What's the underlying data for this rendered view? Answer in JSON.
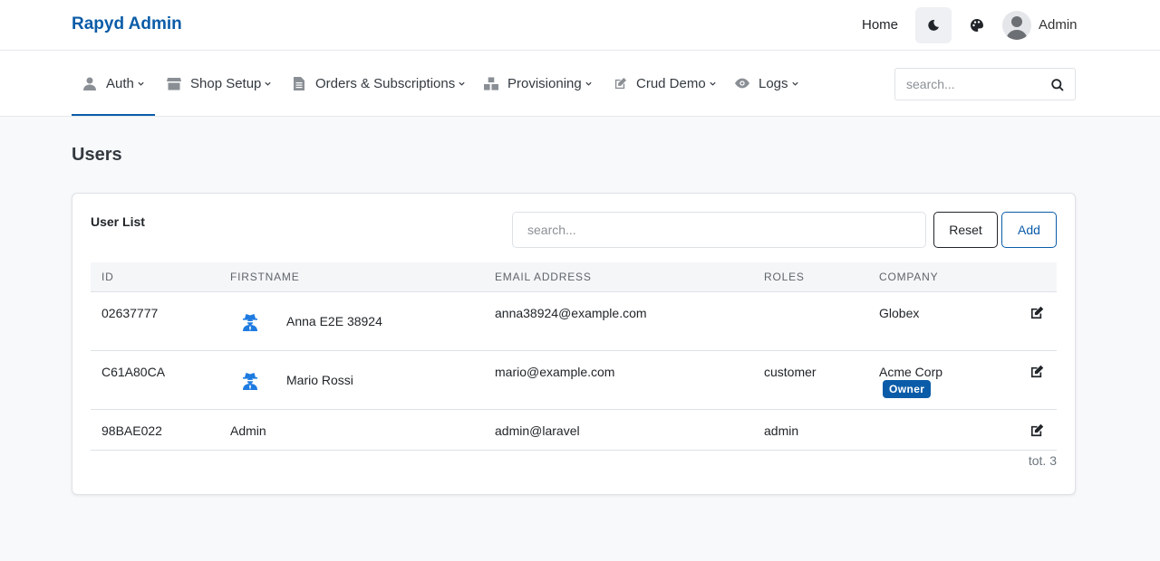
{
  "header": {
    "brand": "Rapyd Admin",
    "home_link": "Home",
    "user_name": "Admin"
  },
  "nav": {
    "items": [
      {
        "label": "Auth",
        "icon": "user-icon"
      },
      {
        "label": "Shop Setup",
        "icon": "store-icon"
      },
      {
        "label": "Orders & Subscriptions",
        "icon": "file-icon"
      },
      {
        "label": "Provisioning",
        "icon": "cubes-icon"
      },
      {
        "label": "Crud Demo",
        "icon": "edit-icon"
      },
      {
        "label": "Logs",
        "icon": "eye-icon"
      }
    ],
    "active_index": 0,
    "search_placeholder": "search..."
  },
  "page": {
    "title": "Users"
  },
  "user_list": {
    "title": "User List",
    "search_placeholder": "search...",
    "reset_label": "Reset",
    "add_label": "Add",
    "columns": [
      "ID",
      "FIRSTNAME",
      "EMAIL ADDRESS",
      "ROLES",
      "COMPANY"
    ],
    "rows": [
      {
        "id": "02637777",
        "firstname": "Anna E2E 38924",
        "email": "anna38924@example.com",
        "roles": "",
        "company": "Globex",
        "badge": "",
        "icon": "user-secret-icon"
      },
      {
        "id": "C61A80CA",
        "firstname": "Mario Rossi",
        "email": "mario@example.com",
        "roles": "customer",
        "company": "Acme Corp",
        "badge": "Owner",
        "icon": "user-secret-icon"
      },
      {
        "id": "98BAE022",
        "firstname": "Admin",
        "email": "admin@laravel",
        "roles": "admin",
        "company": "",
        "badge": "",
        "icon": ""
      }
    ],
    "total": "tot. 3"
  },
  "colors": {
    "brand": "#0b5ca8",
    "badge_bg": "#0b5ca8",
    "user_icon": "#1e7be0"
  }
}
